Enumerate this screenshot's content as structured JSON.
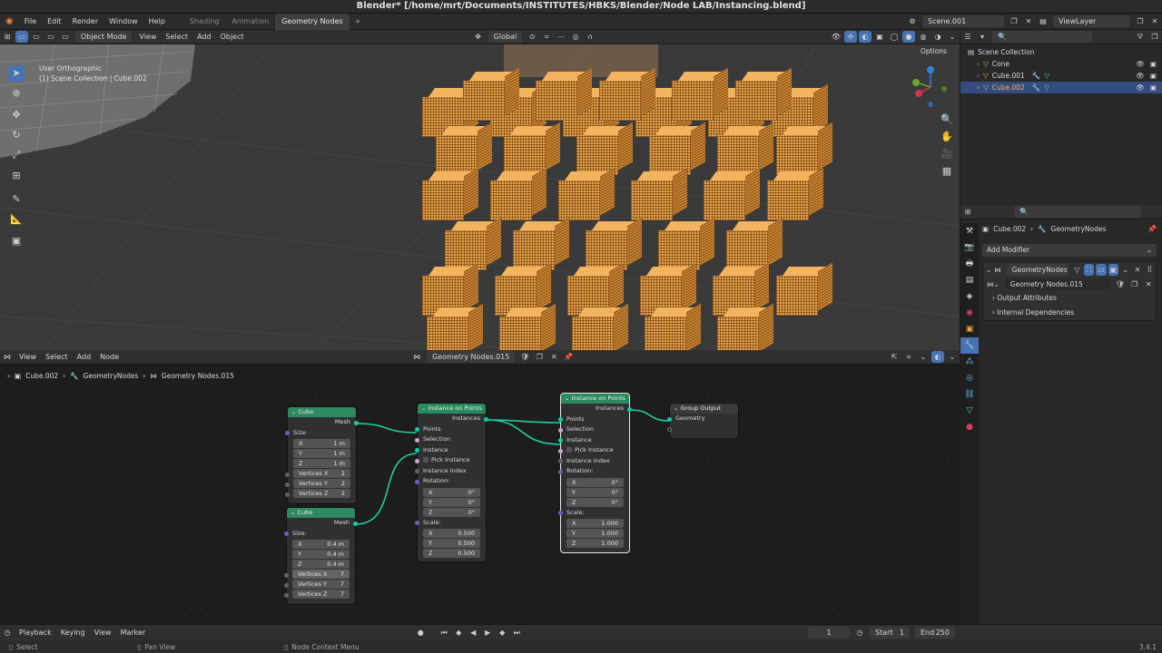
{
  "window_title": "Blender* [/home/mrt/Documents/INSTITUTES/HBKS/Blender/Node LAB/Instancing.blend]",
  "menu": [
    "File",
    "Edit",
    "Render",
    "Window",
    "Help"
  ],
  "workspaces": [
    {
      "label": "Shading",
      "active": false
    },
    {
      "label": "Animation",
      "active": false
    },
    {
      "label": "Geometry Nodes",
      "active": true
    }
  ],
  "scene_name": "Scene.001",
  "view_layer": "ViewLayer",
  "viewport": {
    "mode": "Object Mode",
    "menus": [
      "View",
      "Select",
      "Add",
      "Object"
    ],
    "orientation": "Global",
    "options_label": "Options",
    "overlay_view": "User Orthographic",
    "overlay_collection": "(1) Scene Collection | Cube.002"
  },
  "node_editor": {
    "menus": [
      "View",
      "Select",
      "Add",
      "Node"
    ],
    "tree_name": "Geometry Nodes.015",
    "breadcrumb": [
      "Cube.002",
      "GeometryNodes",
      "Geometry Nodes.015"
    ],
    "nodes": {
      "cube1": {
        "title": "Cube",
        "out_mesh": "Mesh",
        "size_label": "Size:",
        "x": "1 m",
        "y": "1 m",
        "z": "1 m",
        "vx_label": "Vertices X",
        "vx": "2",
        "vy_label": "Vertices Y",
        "vy": "2",
        "vz_label": "Vertices Z",
        "vz": "2"
      },
      "cube2": {
        "title": "Cube",
        "out_mesh": "Mesh",
        "size_label": "Size:",
        "x": "0.4 m",
        "y": "0.4 m",
        "z": "0.4 m",
        "vx_label": "Vertices X",
        "vx": "7",
        "vy_label": "Vertices Y",
        "vy": "7",
        "vz_label": "Vertices Z",
        "vz": "7"
      },
      "iop1": {
        "title": "Instance on Points",
        "out": "Instances",
        "points": "Points",
        "selection": "Selection",
        "instance": "Instance",
        "pick": "Pick Instance",
        "index": "Instance Index",
        "rot_label": "Rotation:",
        "rx": "0°",
        "ry": "0°",
        "rz": "0°",
        "scale_label": "Scale:",
        "sx": "0.500",
        "sy": "0.500",
        "sz": "0.500"
      },
      "iop2": {
        "title": "Instance on Points",
        "out": "Instances",
        "points": "Points",
        "selection": "Selection",
        "instance": "Instance",
        "pick": "Pick Instance",
        "index": "Instance Index",
        "rot_label": "Rotation:",
        "rx": "0°",
        "ry": "0°",
        "rz": "0°",
        "scale_label": "Scale:",
        "sx": "1.000",
        "sy": "1.000",
        "sz": "1.000"
      },
      "out": {
        "title": "Group Output",
        "geometry": "Geometry"
      }
    },
    "axis": {
      "x": "X",
      "y": "Y",
      "z": "Z"
    }
  },
  "outliner": {
    "root": "Scene Collection",
    "items": [
      {
        "name": "Cone",
        "selected": false
      },
      {
        "name": "Cube.001",
        "selected": false
      },
      {
        "name": "Cube.002",
        "selected": true
      }
    ]
  },
  "properties": {
    "object": "Cube.002",
    "modifier_crumb": "GeometryNodes",
    "add_modifier": "Add Modifier",
    "modifier_name": "GeometryNodes",
    "node_group": "Geometry Nodes.015",
    "panels": [
      "Output Attributes",
      "Internal Dependencies"
    ]
  },
  "timeline": {
    "menus": [
      "Playback",
      "Keying",
      "View",
      "Marker"
    ],
    "current_frame": "1",
    "start_label": "Start",
    "start": "1",
    "end_label": "End",
    "end": "250"
  },
  "status": {
    "select": "Select",
    "pan": "Pan View",
    "context": "Node Context Menu",
    "version": "3.4.1"
  },
  "colors": {
    "accent": "#4772b3",
    "geometry_socket": "#00d6a3",
    "node_header": "#2d8a63",
    "selection": "#e8a248"
  }
}
